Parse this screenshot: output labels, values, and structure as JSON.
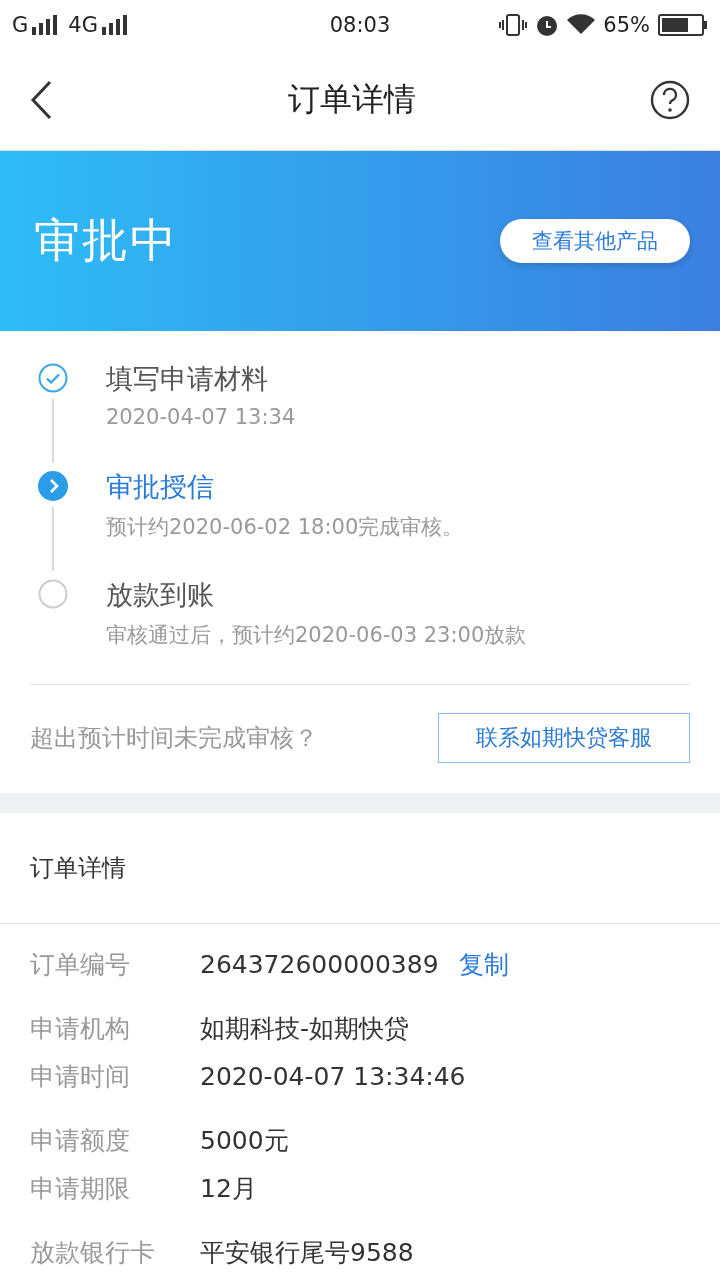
{
  "status_bar": {
    "carrier_1": "G",
    "carrier_2": "4G",
    "time": "08:03",
    "battery": "65%"
  },
  "header": {
    "title": "订单详情"
  },
  "banner": {
    "status": "审批中",
    "button": "查看其他产品"
  },
  "steps": [
    {
      "title": "填写申请材料",
      "detail": "2020-04-07 13:34",
      "kind": "done"
    },
    {
      "title": "审批授信",
      "detail": "预计约2020-06-02 18:00完成审核。",
      "kind": "current"
    },
    {
      "title": "放款到账",
      "detail": "审核通过后，预计约2020-06-03 23:00放款",
      "kind": "pending"
    }
  ],
  "help": {
    "question": "超出预计时间未完成审核？",
    "button": "联系如期快贷客服"
  },
  "order": {
    "title": "订单详情",
    "groups": [
      [
        {
          "label": "订单编号",
          "value": "264372600000389",
          "action": "复制"
        }
      ],
      [
        {
          "label": "申请机构",
          "value": "如期科技-如期快贷"
        },
        {
          "label": "申请时间",
          "value": "2020-04-07 13:34:46"
        }
      ],
      [
        {
          "label": "申请额度",
          "value": "5000元"
        },
        {
          "label": "申请期限",
          "value": "12月"
        }
      ],
      [
        {
          "label": "放款银行卡",
          "value": "平安银行尾号9588"
        }
      ]
    ]
  }
}
